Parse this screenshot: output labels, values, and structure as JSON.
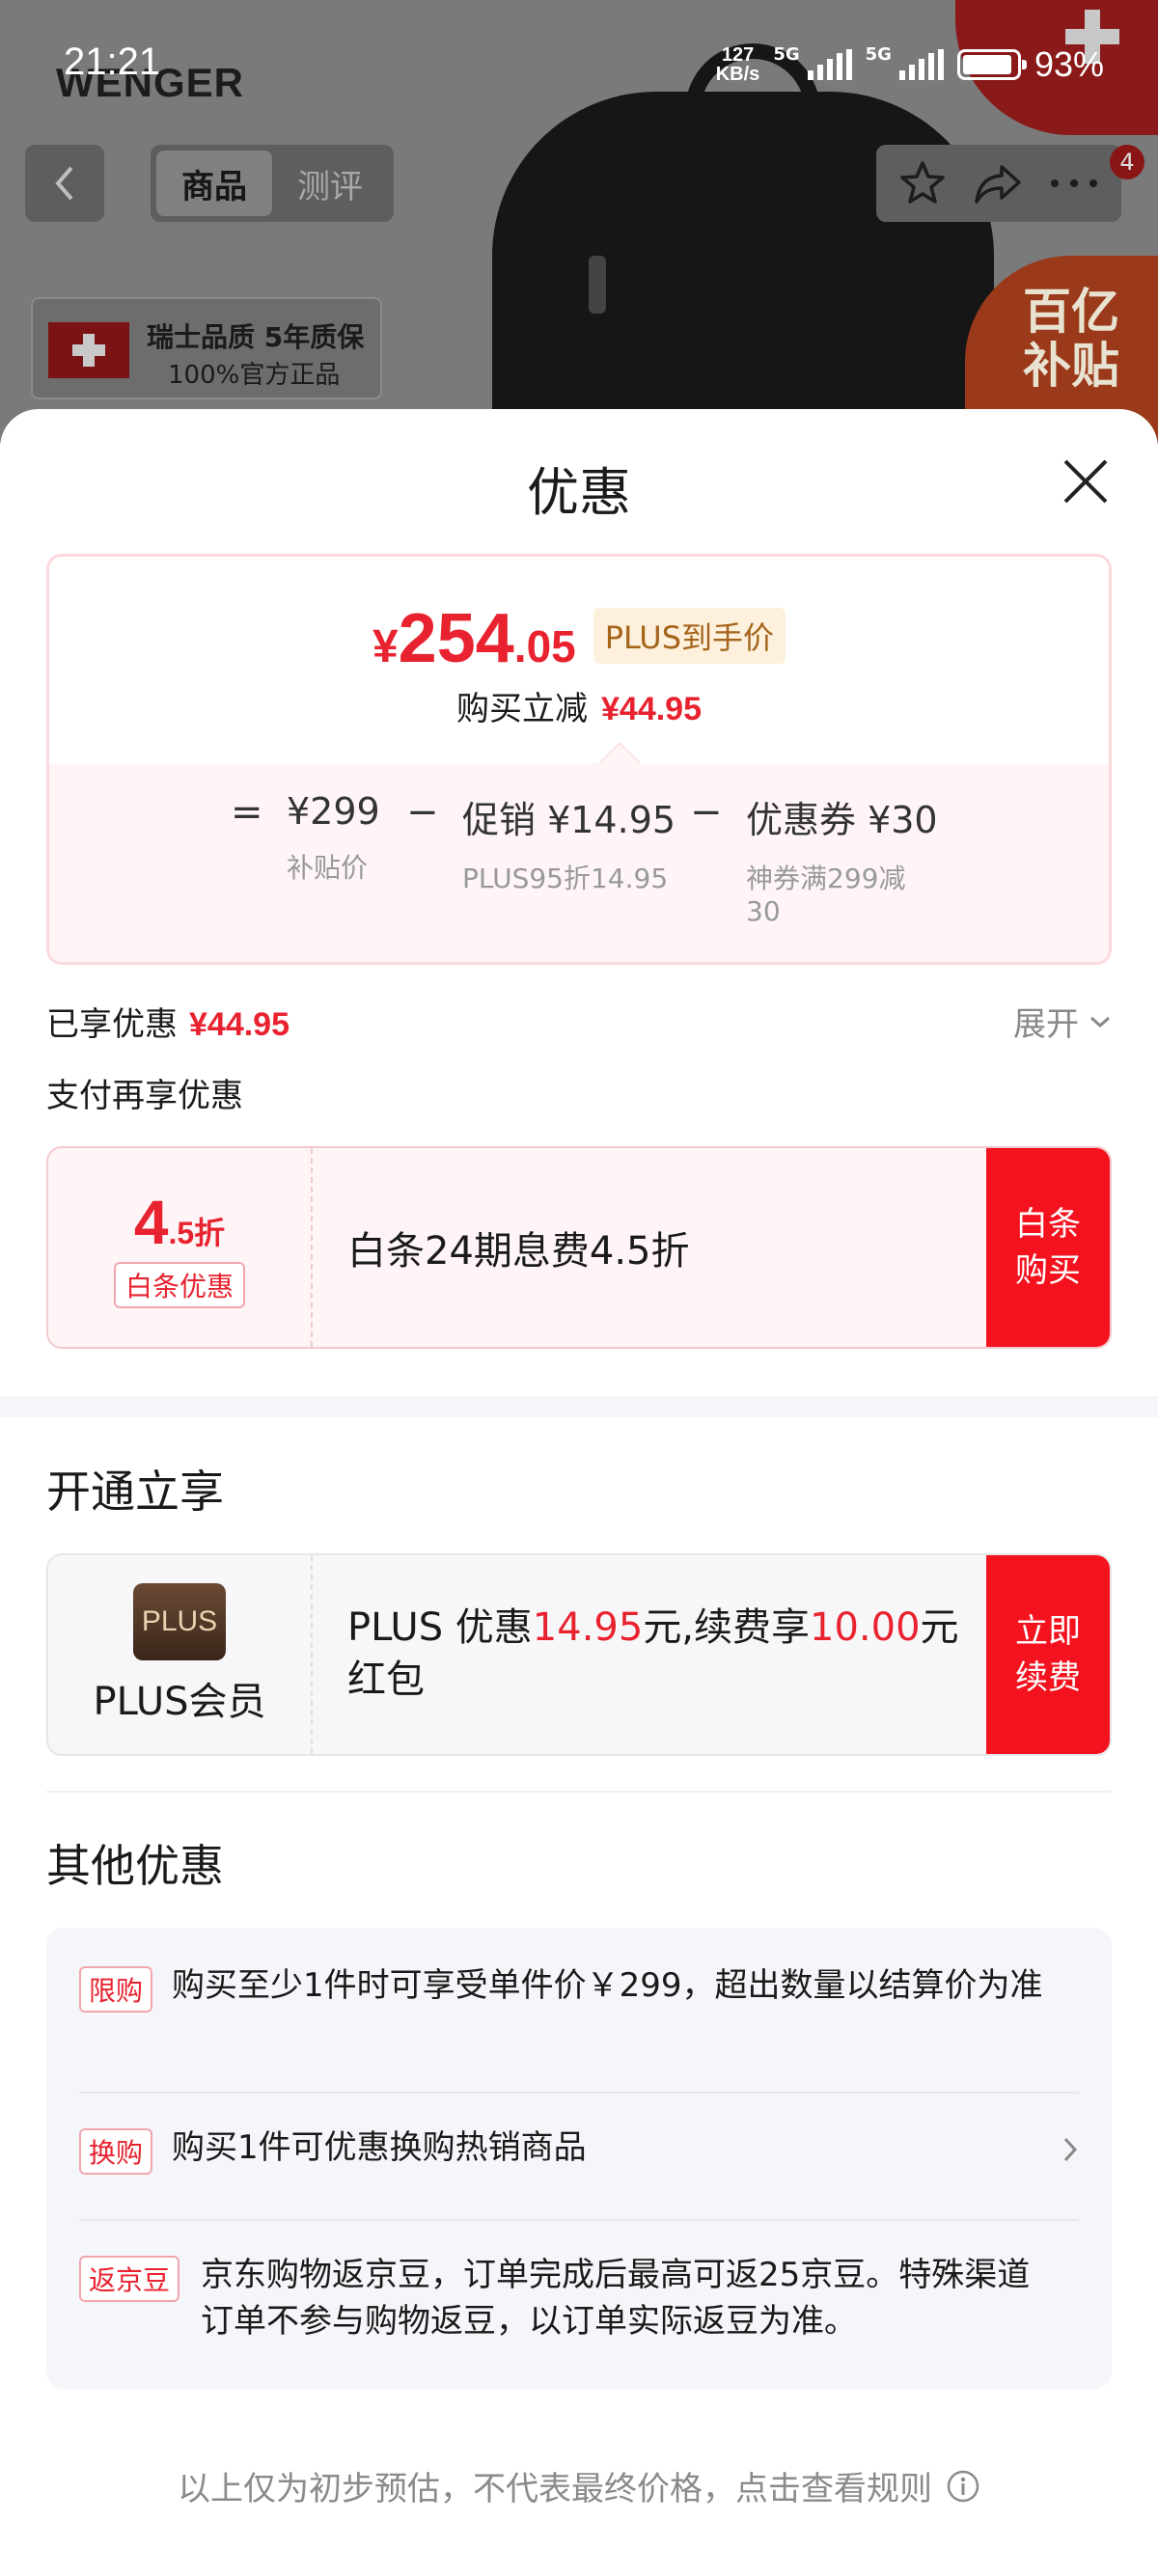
{
  "status_bar": {
    "time": "21:21",
    "net_speed_value": "127",
    "net_speed_unit": "KB/s",
    "sim1_label": "5G",
    "sim2_label": "5G",
    "battery_pct": "93%"
  },
  "background": {
    "brand": "WENGER",
    "tabs": [
      {
        "label": "商品",
        "active": true
      },
      {
        "label": "测评",
        "active": false
      }
    ],
    "quality_line1": "瑞士品质 5年质保",
    "quality_line2": "100%官方正品",
    "subsidy_line1": "百亿",
    "subsidy_line2": "补贴",
    "more_badge": "4"
  },
  "sheet": {
    "title": "优惠",
    "price_card": {
      "currency": "¥",
      "price_int": "254",
      "price_dec": ".05",
      "plus_tag": "PLUS到手价",
      "reduce_label": "购买立减",
      "reduce_amount": "¥44.95",
      "formula": [
        {
          "op": "=",
          "value": "¥299",
          "label": "补贴价"
        },
        {
          "op": "−",
          "value": "促销 ¥14.95",
          "label": "PLUS95折14.95"
        },
        {
          "op": "−",
          "value": "优惠券 ¥30",
          "label_line1": "神券满299减",
          "label_line2": "30"
        }
      ]
    },
    "enjoyed_label": "已享优惠",
    "enjoyed_amount": "¥44.95",
    "expand_label": "展开",
    "pay_again_label": "支付再享优惠",
    "baitiao": {
      "disc_big": "4",
      "disc_small": ".5折",
      "tag": "白条优惠",
      "desc": "白条24期息费4.5折",
      "action_line1": "白条",
      "action_line2": "购买"
    },
    "open_title": "开通立享",
    "plus_member": {
      "logo_text": "PLUS",
      "name": "PLUS会员",
      "desc_part1": "PLUS 优惠",
      "desc_amt1": "14.95",
      "desc_part2": "元,续费享",
      "desc_amt2": "10.00",
      "desc_part3": "元",
      "desc_part4": "红包",
      "action_line1": "立即",
      "action_line2": "续费"
    },
    "others_title": "其他优惠",
    "others": [
      {
        "tag": "限购",
        "text": "购买至少1件时可享受单件价￥299，超出数量以结算价为准"
      },
      {
        "tag": "换购",
        "text": "购买1件可优惠换购热销商品"
      },
      {
        "tag": "返京豆",
        "text": "京东购物返京豆，订单完成后最高可返25京豆。特殊渠道订单不参与购物返豆，以订单实际返豆为准。"
      }
    ],
    "footer_note": "以上仅为初步预估，不代表最终价格，点击查看规则"
  },
  "colors": {
    "accent_red": "#e8222f",
    "button_red": "#f4121e",
    "plus_gold": "#a5641a"
  }
}
